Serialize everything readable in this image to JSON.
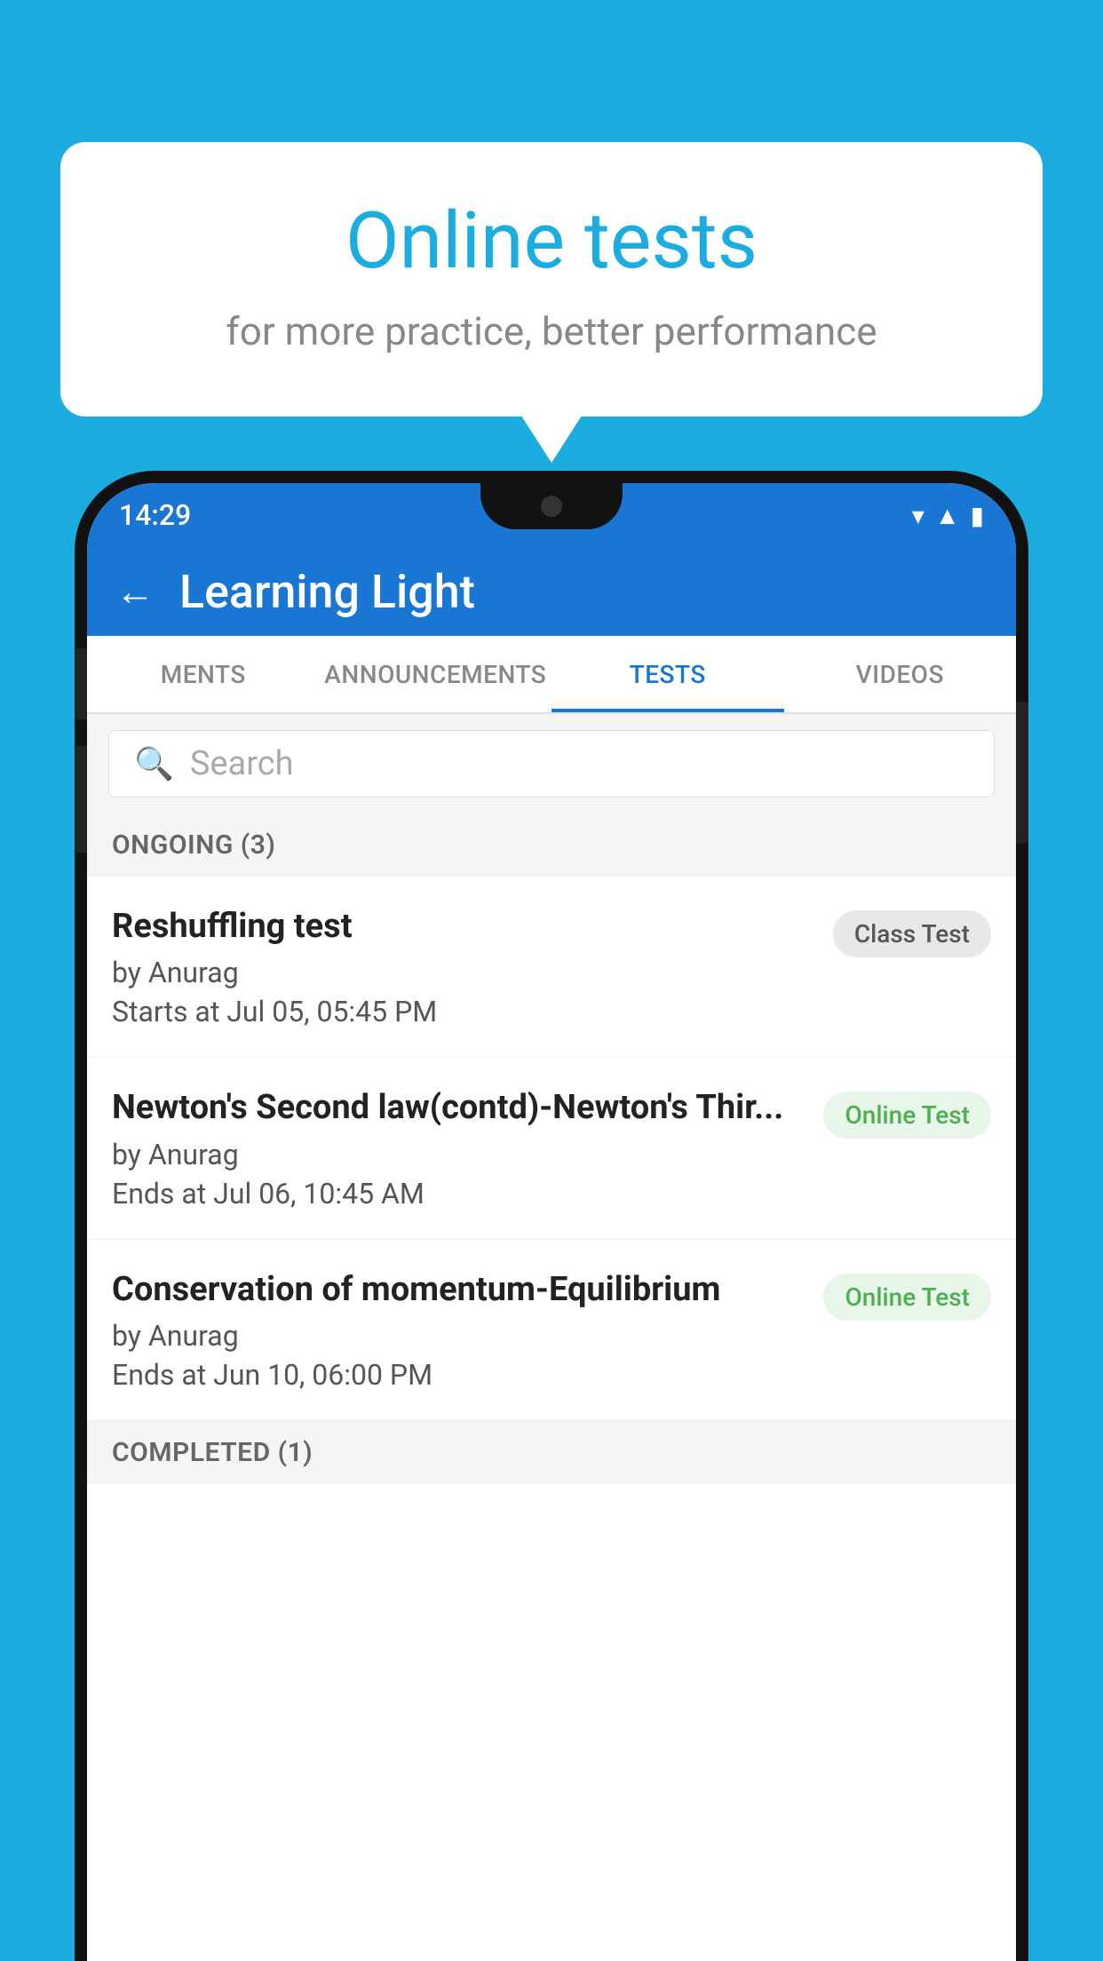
{
  "background": {
    "color": "#1BACE0"
  },
  "speech_bubble": {
    "title": "Online tests",
    "subtitle": "for more practice, better performance"
  },
  "phone": {
    "status_bar": {
      "time": "14:29",
      "icons": [
        "wifi",
        "signal",
        "battery"
      ]
    },
    "app_bar": {
      "title": "Learning Light",
      "back_label": "←"
    },
    "tabs": [
      {
        "label": "MENTS",
        "active": false
      },
      {
        "label": "ANNOUNCEMENTS",
        "active": false
      },
      {
        "label": "TESTS",
        "active": true
      },
      {
        "label": "VIDEOS",
        "active": false
      }
    ],
    "search": {
      "placeholder": "Search"
    },
    "ongoing_section": {
      "header": "ONGOING (3)",
      "tests": [
        {
          "title": "Reshuffling test",
          "author": "by Anurag",
          "date": "Starts at  Jul 05, 05:45 PM",
          "badge": "Class Test",
          "badge_type": "class"
        },
        {
          "title": "Newton's Second law(contd)-Newton's Thir...",
          "author": "by Anurag",
          "date": "Ends at  Jul 06, 10:45 AM",
          "badge": "Online Test",
          "badge_type": "online"
        },
        {
          "title": "Conservation of momentum-Equilibrium",
          "author": "by Anurag",
          "date": "Ends at  Jun 10, 06:00 PM",
          "badge": "Online Test",
          "badge_type": "online"
        }
      ]
    },
    "completed_section": {
      "header": "COMPLETED (1)"
    }
  }
}
